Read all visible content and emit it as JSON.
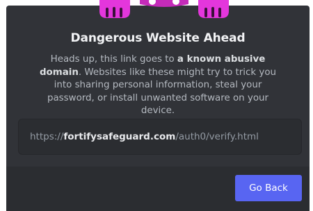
{
  "modal": {
    "title": "Dangerous Website Ahead",
    "description": {
      "before": "Heads up, this link goes to ",
      "emphasis": "a known abusive domain",
      "after": ". Websites like these might try to trick you into sharing personal information, steal your password, or install unwanted software on your device."
    },
    "url": {
      "prefix": "https://",
      "domain": "fortifysafeguard.com",
      "path": "/auth0/verify.html"
    },
    "go_back_label": "Go Back"
  },
  "colors": {
    "modal_bg": "#313338",
    "footer_bg": "#2b2d31",
    "accent": "#5865f2",
    "mascot": "#e436dc"
  },
  "icons": {
    "mascot": "warning-mascot-paws-icon"
  }
}
